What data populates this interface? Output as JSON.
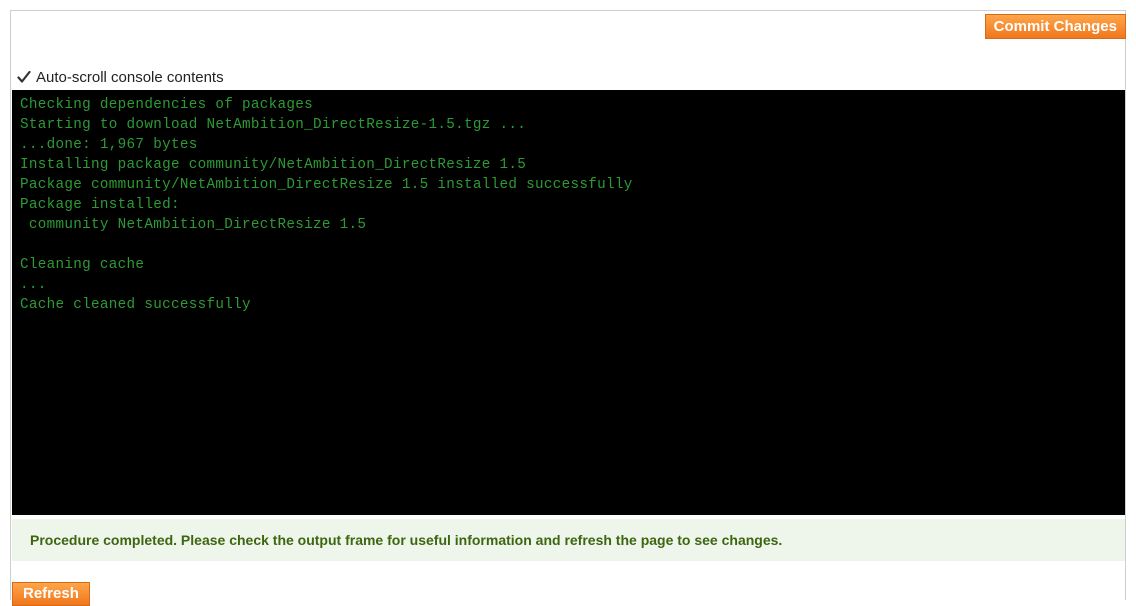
{
  "toolbar": {
    "commit_label": "Commit Changes"
  },
  "autoscroll": {
    "label": "Auto-scroll console contents",
    "checked": true
  },
  "console": {
    "lines": [
      "Checking dependencies of packages",
      "Starting to download NetAmbition_DirectResize-1.5.tgz ...",
      "...done: 1,967 bytes",
      "Installing package community/NetAmbition_DirectResize 1.5",
      "Package community/NetAmbition_DirectResize 1.5 installed successfully",
      "Package installed:",
      " community NetAmbition_DirectResize 1.5",
      "",
      "Cleaning cache",
      "...",
      "Cache cleaned successfully"
    ],
    "text_color": "#2e9a35",
    "background": "#000000"
  },
  "notice": {
    "message": "Procedure completed. Please check the output frame for useful information and refresh the page to see changes."
  },
  "footer": {
    "refresh_label": "Refresh"
  },
  "colors": {
    "accent": "#f0771c",
    "notice_bg": "#eef5ea",
    "notice_text": "#3d6611"
  }
}
